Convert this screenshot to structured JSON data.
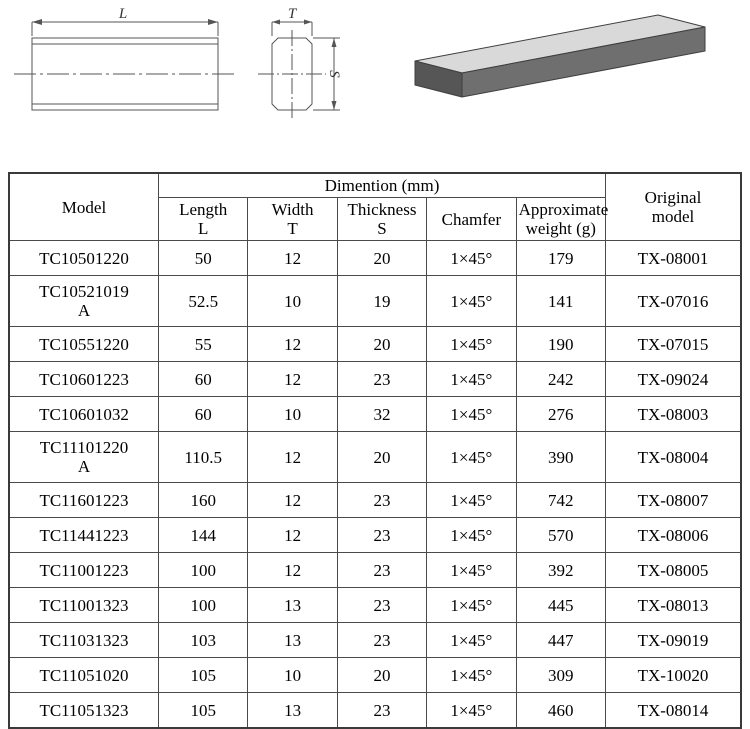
{
  "drawings": {
    "side_view": {
      "dimension_label": "L",
      "name": "side-elevation-view"
    },
    "section_view": {
      "width_label": "T",
      "height_label": "S",
      "name": "cross-section-view"
    },
    "isometric_view": {
      "name": "isometric-bar-render",
      "colors": {
        "top_face": "#d9d9d9",
        "front_face": "#6f6f6f",
        "end_face": "#565656",
        "outline": "#3f3f3f"
      }
    },
    "line_color": "#555555"
  },
  "table": {
    "header": {
      "model": "Model",
      "dimention_group": "Dimention (mm)",
      "length": "Length",
      "length_symbol": "L",
      "width": "Width",
      "width_symbol": "T",
      "thickness": "Thickness",
      "thickness_symbol": "S",
      "chamfer": "Chamfer",
      "weight_line1": "Approximate",
      "weight_line2": "weight (g)",
      "original_line1": "Original",
      "original_line2": "model"
    },
    "rows": [
      {
        "model": "TC10501220",
        "model_line2": "",
        "length": "50",
        "width": "12",
        "thickness": "20",
        "chamfer": "1×45°",
        "weight": "179",
        "original": "TX-08001",
        "tall": false
      },
      {
        "model": "TC10521019",
        "model_line2": "A",
        "length": "52.5",
        "width": "10",
        "thickness": "19",
        "chamfer": "1×45°",
        "weight": "141",
        "original": "TX-07016",
        "tall": true
      },
      {
        "model": "TC10551220",
        "model_line2": "",
        "length": "55",
        "width": "12",
        "thickness": "20",
        "chamfer": "1×45°",
        "weight": "190",
        "original": "TX-07015",
        "tall": false
      },
      {
        "model": "TC10601223",
        "model_line2": "",
        "length": "60",
        "width": "12",
        "thickness": "23",
        "chamfer": "1×45°",
        "weight": "242",
        "original": "TX-09024",
        "tall": false
      },
      {
        "model": "TC10601032",
        "model_line2": "",
        "length": "60",
        "width": "10",
        "thickness": "32",
        "chamfer": "1×45°",
        "weight": "276",
        "original": "TX-08003",
        "tall": false
      },
      {
        "model": "TC11101220",
        "model_line2": "A",
        "length": "110.5",
        "width": "12",
        "thickness": "20",
        "chamfer": "1×45°",
        "weight": "390",
        "original": "TX-08004",
        "tall": true
      },
      {
        "model": "TC11601223",
        "model_line2": "",
        "length": "160",
        "width": "12",
        "thickness": "23",
        "chamfer": "1×45°",
        "weight": "742",
        "original": "TX-08007",
        "tall": false
      },
      {
        "model": "TC11441223",
        "model_line2": "",
        "length": "144",
        "width": "12",
        "thickness": "23",
        "chamfer": "1×45°",
        "weight": "570",
        "original": "TX-08006",
        "tall": false
      },
      {
        "model": "TC11001223",
        "model_line2": "",
        "length": "100",
        "width": "12",
        "thickness": "23",
        "chamfer": "1×45°",
        "weight": "392",
        "original": "TX-08005",
        "tall": false
      },
      {
        "model": "TC11001323",
        "model_line2": "",
        "length": "100",
        "width": "13",
        "thickness": "23",
        "chamfer": "1×45°",
        "weight": "445",
        "original": "TX-08013",
        "tall": false
      },
      {
        "model": "TC11031323",
        "model_line2": "",
        "length": "103",
        "width": "13",
        "thickness": "23",
        "chamfer": "1×45°",
        "weight": "447",
        "original": "TX-09019",
        "tall": false
      },
      {
        "model": "TC11051020",
        "model_line2": "",
        "length": "105",
        "width": "10",
        "thickness": "20",
        "chamfer": "1×45°",
        "weight": "309",
        "original": "TX-10020",
        "tall": false
      },
      {
        "model": "TC11051323",
        "model_line2": "",
        "length": "105",
        "width": "13",
        "thickness": "23",
        "chamfer": "1×45°",
        "weight": "460",
        "original": "TX-08014",
        "tall": false
      }
    ]
  }
}
